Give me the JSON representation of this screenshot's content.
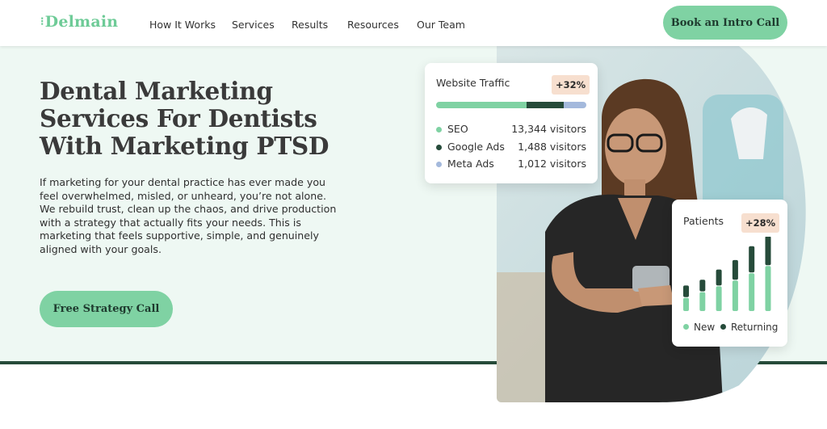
{
  "brand": {
    "logo_text": "Delmain",
    "accent": "#7fd2a3",
    "dark_green": "#264b3a"
  },
  "nav": {
    "items": [
      "How It Works",
      "Services",
      "Results",
      "Resources",
      "Our Team"
    ],
    "cta": "Book an Intro Call"
  },
  "hero": {
    "title_lines": [
      "Dental Marketing",
      "Services For Dentists",
      "With Marketing PTSD"
    ],
    "body": "If marketing for your dental practice has ever made you feel overwhelmed, misled, or unheard, you’re not alone. We rebuild trust, clean up the chaos, and drive production with a strategy that actually fits your needs. This is marketing that feels supportive, simple, and genuinely aligned with your goals.",
    "cta": "Free Strategy Call"
  },
  "traffic_card": {
    "title": "Website Traffic",
    "badge": "+32%",
    "rows": [
      {
        "label": "SEO",
        "value": "13,344 visitors",
        "color": "#7fd2a3",
        "share": 0.6
      },
      {
        "label": "Google Ads",
        "value": "1,488 visitors",
        "color": "#264b3a",
        "share": 0.25
      },
      {
        "label": "Meta Ads",
        "value": "1,012 visitors",
        "color": "#a4b9dc",
        "share": 0.15
      }
    ]
  },
  "patients_card": {
    "title": "Patients",
    "badge": "+28%",
    "legend": [
      "New",
      "Returning"
    ],
    "colors": {
      "new": "#7fd2a3",
      "returning": "#264b3a"
    },
    "bars": [
      {
        "new": 0.18,
        "returning": 0.16
      },
      {
        "new": 0.26,
        "returning": 0.16
      },
      {
        "new": 0.34,
        "returning": 0.22
      },
      {
        "new": 0.42,
        "returning": 0.27
      },
      {
        "new": 0.52,
        "returning": 0.36
      },
      {
        "new": 0.62,
        "returning": 0.4
      }
    ]
  }
}
